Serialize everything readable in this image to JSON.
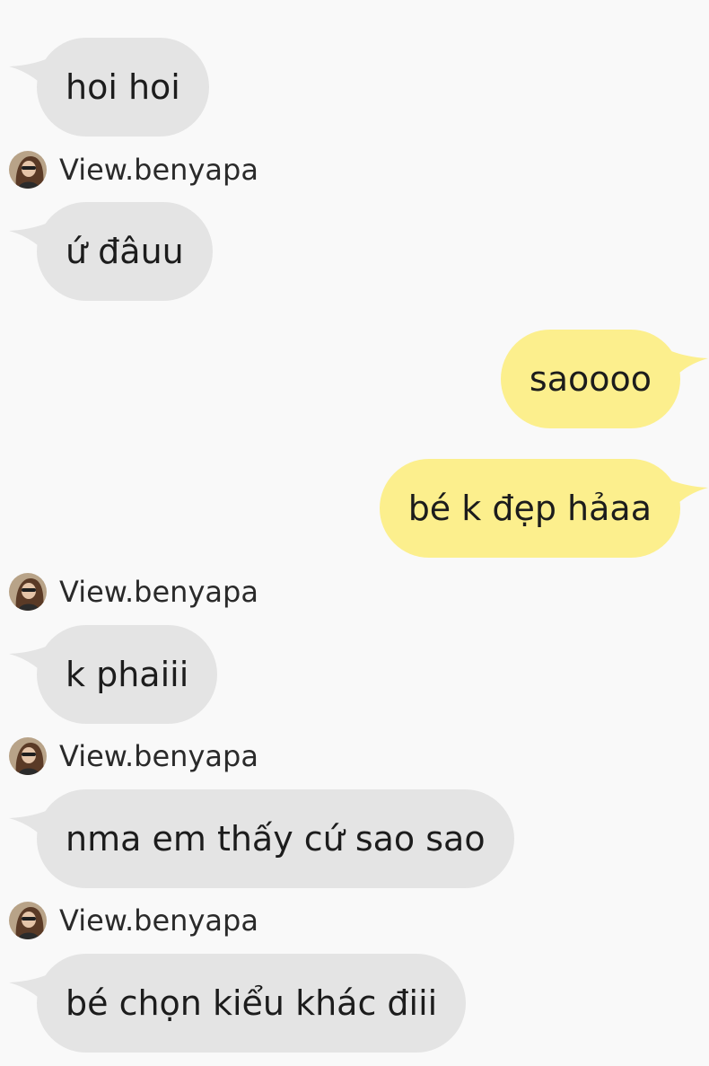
{
  "colors": {
    "background": "#f9f9f9",
    "incoming_bubble": "#e4e4e4",
    "outgoing_bubble": "#fcef8d",
    "text": "#1c1c1c"
  },
  "messages": [
    {
      "direction": "incoming",
      "text": "hoi hoi"
    },
    {
      "direction": "incoming",
      "sender": "View.benyapa",
      "avatar_icon": "profile-photo-icon",
      "text": "ứ đâuu"
    },
    {
      "direction": "outgoing",
      "text": "saoooo"
    },
    {
      "direction": "outgoing",
      "text": "bé k đẹp hảaa"
    },
    {
      "direction": "incoming",
      "sender": "View.benyapa",
      "avatar_icon": "profile-photo-icon",
      "text": "k phaiii"
    },
    {
      "direction": "incoming",
      "sender": "View.benyapa",
      "avatar_icon": "profile-photo-icon",
      "text": "nma em thấy cứ sao sao"
    },
    {
      "direction": "incoming",
      "sender": "View.benyapa",
      "avatar_icon": "profile-photo-icon",
      "text": "bé chọn kiểu khác điii"
    }
  ]
}
